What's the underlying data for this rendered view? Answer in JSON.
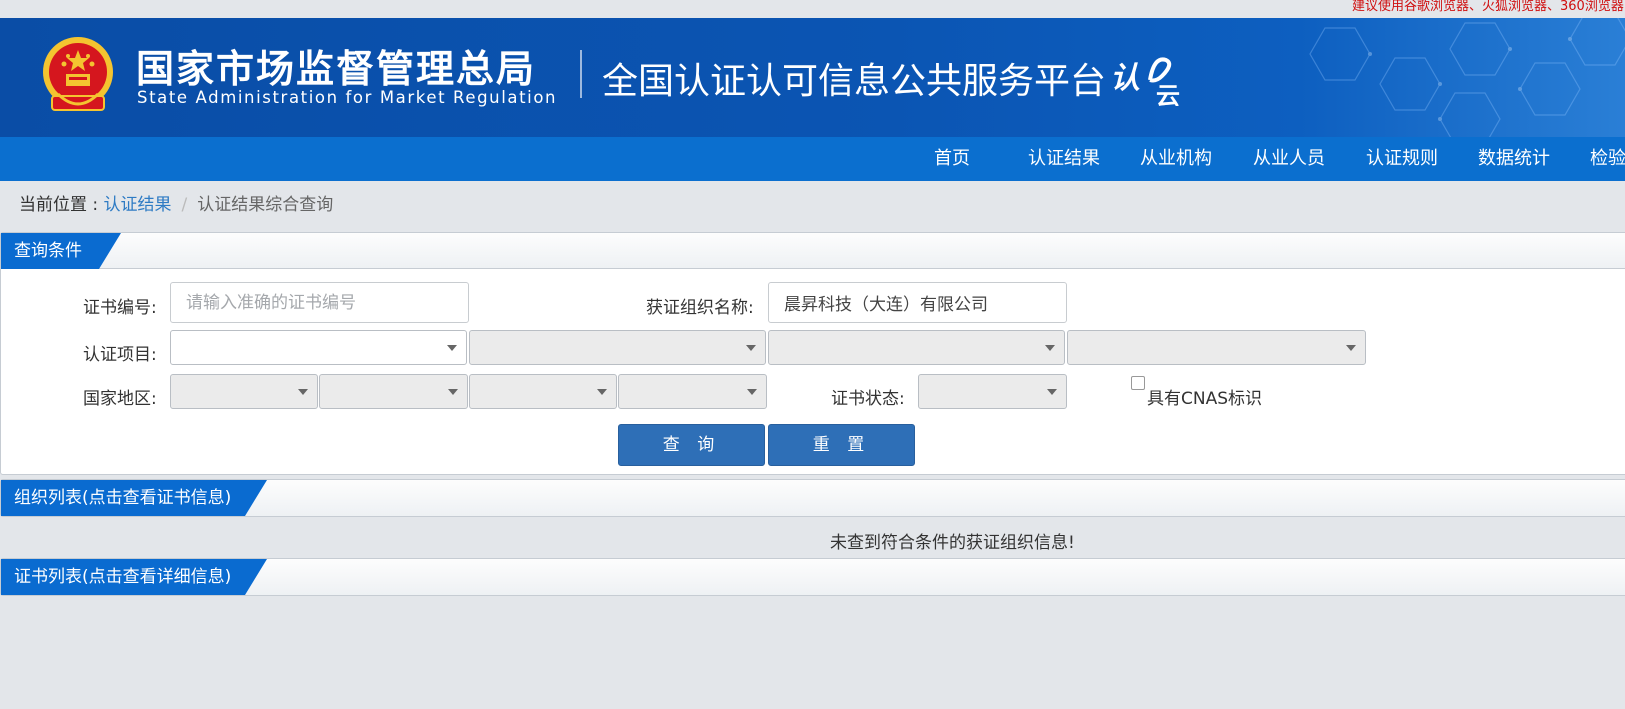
{
  "top_notice": "建议使用谷歌浏览器、火狐浏览器、360浏览器",
  "header": {
    "org_name_cn": "国家市场监督管理总局",
    "org_name_en": "State Administration  for  Market Regulation",
    "platform_title": "全国认证认可信息公共服务平台",
    "logo_text": "认云"
  },
  "nav": {
    "items": [
      "首页",
      "认证结果",
      "从业机构",
      "从业人员",
      "认证规则",
      "数据统计",
      "检验"
    ]
  },
  "breadcrumb": {
    "prefix": "当前位置 : ",
    "link": "认证结果",
    "separator": "/",
    "current": "认证结果综合查询"
  },
  "query_panel": {
    "title": "查询条件",
    "cert_no_label": "证书编号:",
    "cert_no_placeholder": "请输入准确的证书编号",
    "cert_no_value": "",
    "org_name_label": "获证组织名称:",
    "org_name_value": "晨昇科技（大连）有限公司",
    "project_label": "认证项目:",
    "region_label": "国家地区:",
    "status_label": "证书状态:",
    "cnas_label": "具有CNAS标识",
    "cnas_checked": false,
    "search_button": "查 询",
    "reset_button": "重 置"
  },
  "org_list": {
    "title": "组织列表(点击查看证书信息)",
    "empty_message": "未查到符合条件的获证组织信息!"
  },
  "cert_list": {
    "title": "证书列表(点击查看详细信息)"
  },
  "colors": {
    "header_blue": "#0b55b3",
    "nav_blue": "#0b6fcf",
    "tab_blue": "#0a6bd0",
    "button_blue": "#2e6fb7",
    "notice_red": "#d01010",
    "page_bg": "#e3e6ea"
  }
}
